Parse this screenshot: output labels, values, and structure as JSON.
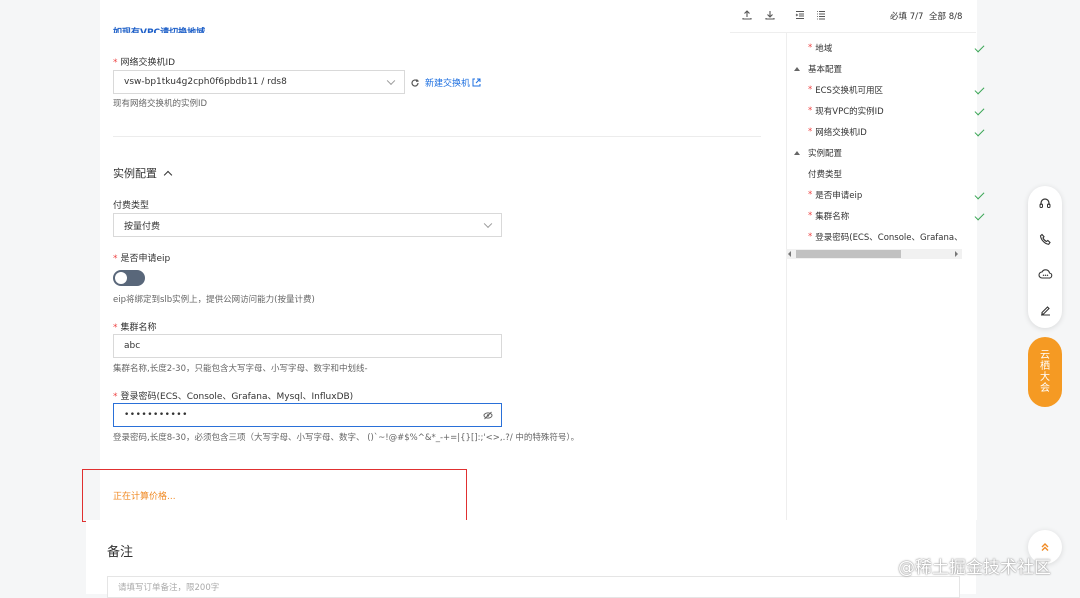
{
  "top_partial_text": "如现有VPC请切换地域。",
  "toolbar": {
    "required_count": "必填 7/7",
    "all_count": "全部 8/8"
  },
  "vswitch": {
    "label": "网络交换机ID",
    "value": "vsw-bp1tku4g2cph0f6pbdb11 / rds8",
    "new_link": "新建交换机",
    "hint": "现有网络交换机的实例ID"
  },
  "instance_section": {
    "title": "实例配置"
  },
  "billing": {
    "label": "付费类型",
    "value": "按量付费"
  },
  "elip": {
    "label": "是否申请eip",
    "hint": "eip将绑定到slb实例上，提供公网访问能力(按量计费)"
  },
  "cluster": {
    "label": "集群名称",
    "value": "abc",
    "hint": "集群名称,长度2-30，只能包含大写字母、小写字母、数字和中划线-"
  },
  "password": {
    "label": "登录密码(ECS、Console、Grafana、Mysql、InfluxDB)",
    "value": "•••••••••••",
    "hint": "登录密码,长度8-30，必须包含三项（大写字母、小写字母、数字、 ()`~!@#$%^&*_-+=|{}[]:;'<>,.?/ 中的特殊符号）。"
  },
  "price": {
    "text": "正在计算价格..."
  },
  "remark": {
    "title": "备注",
    "placeholder": "请填写订单备注，限200字"
  },
  "tree": [
    {
      "label": "地域",
      "required": true,
      "checked": true,
      "level": 1
    },
    {
      "label": "基本配置",
      "group": true
    },
    {
      "label": "ECS交换机可用区",
      "required": true,
      "checked": true,
      "level": 1
    },
    {
      "label": "现有VPC的实例ID",
      "required": true,
      "checked": true,
      "level": 1
    },
    {
      "label": "网络交换机ID",
      "required": true,
      "checked": true,
      "level": 1
    },
    {
      "label": "实例配置",
      "group": true
    },
    {
      "label": "付费类型",
      "required": false,
      "checked": false,
      "level": 1
    },
    {
      "label": "是否申请eip",
      "required": true,
      "checked": true,
      "level": 1
    },
    {
      "label": "集群名称",
      "required": true,
      "checked": true,
      "level": 1
    },
    {
      "label": "登录密码(ECS、Console、Grafana、",
      "required": true,
      "checked": false,
      "level": 1
    }
  ],
  "float_buttons": [
    "headset-icon",
    "phone-icon",
    "cloud-chat-icon",
    "edit-icon"
  ],
  "yunqi": {
    "chars": [
      "云",
      "栖",
      "大",
      "会"
    ]
  },
  "watermark": "@稀土掘金技术社区",
  "colors": {
    "accent": "#1d6fe0",
    "price": "#f08a24",
    "highlight": "#e03030",
    "check": "#3aa655",
    "badge": "#f59a23"
  }
}
